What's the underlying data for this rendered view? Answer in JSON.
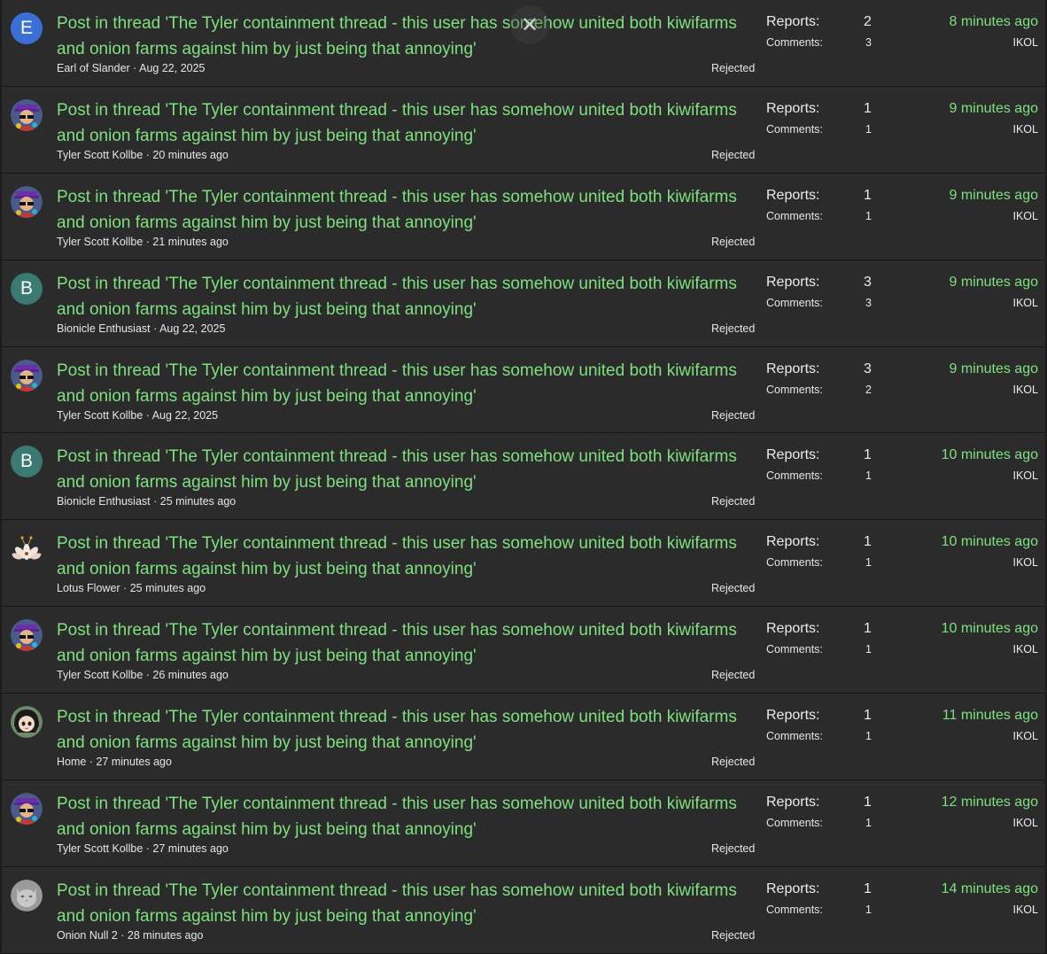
{
  "labels": {
    "reports": "Reports:",
    "comments": "Comments:"
  },
  "overlay": {
    "close_glyph": "✕"
  },
  "reports": [
    {
      "title": "Post in thread 'The Tyler containment thread - this user has somehow united both kiwifarms and onion farms against him by just being that annoying'",
      "author": "Earl of Slander",
      "date": "Aug 22, 2025",
      "status": "Rejected",
      "reports": "2",
      "comments": "3",
      "time": "8 minutes ago",
      "assignee": "IKOL",
      "avatar": {
        "type": "letter",
        "letter": "E",
        "color": "#3c6ed8",
        "icon": "letter-avatar"
      }
    },
    {
      "title": "Post in thread 'The Tyler containment thread - this user has somehow united both kiwifarms and onion farms against him by just being that annoying'",
      "author": "Tyler Scott Kollbe",
      "date": "20 minutes ago",
      "status": "Rejected",
      "reports": "1",
      "comments": "1",
      "time": "9 minutes ago",
      "assignee": "IKOL",
      "avatar": {
        "type": "tyler",
        "icon": "tyler-avatar"
      }
    },
    {
      "title": "Post in thread 'The Tyler containment thread - this user has somehow united both kiwifarms and onion farms against him by just being that annoying'",
      "author": "Tyler Scott Kollbe",
      "date": "21 minutes ago",
      "status": "Rejected",
      "reports": "1",
      "comments": "1",
      "time": "9 minutes ago",
      "assignee": "IKOL",
      "avatar": {
        "type": "tyler",
        "icon": "tyler-avatar"
      }
    },
    {
      "title": "Post in thread 'The Tyler containment thread - this user has somehow united both kiwifarms and onion farms against him by just being that annoying'",
      "author": "Bionicle Enthusiast",
      "date": "Aug 22, 2025",
      "status": "Rejected",
      "reports": "3",
      "comments": "3",
      "time": "9 minutes ago",
      "assignee": "IKOL",
      "avatar": {
        "type": "letter",
        "letter": "B",
        "color": "#3b7a73",
        "icon": "letter-avatar"
      }
    },
    {
      "title": "Post in thread 'The Tyler containment thread - this user has somehow united both kiwifarms and onion farms against him by just being that annoying'",
      "author": "Tyler Scott Kollbe",
      "date": "Aug 22, 2025",
      "status": "Rejected",
      "reports": "3",
      "comments": "2",
      "time": "9 minutes ago",
      "assignee": "IKOL",
      "avatar": {
        "type": "tyler",
        "icon": "tyler-avatar"
      }
    },
    {
      "title": "Post in thread 'The Tyler containment thread - this user has somehow united both kiwifarms and onion farms against him by just being that annoying'",
      "author": "Bionicle Enthusiast",
      "date": "25 minutes ago",
      "status": "Rejected",
      "reports": "1",
      "comments": "1",
      "time": "10 minutes ago",
      "assignee": "IKOL",
      "avatar": {
        "type": "letter",
        "letter": "B",
        "color": "#3b7a73",
        "icon": "letter-avatar"
      }
    },
    {
      "title": "Post in thread 'The Tyler containment thread - this user has somehow united both kiwifarms and onion farms against him by just being that annoying'",
      "author": "Lotus Flower",
      "date": "25 minutes ago",
      "status": "Rejected",
      "reports": "1",
      "comments": "1",
      "time": "10 minutes ago",
      "assignee": "IKOL",
      "avatar": {
        "type": "lotus",
        "icon": "lotus-flower-avatar"
      }
    },
    {
      "title": "Post in thread 'The Tyler containment thread - this user has somehow united both kiwifarms and onion farms against him by just being that annoying'",
      "author": "Tyler Scott Kollbe",
      "date": "26 minutes ago",
      "status": "Rejected",
      "reports": "1",
      "comments": "1",
      "time": "10 minutes ago",
      "assignee": "IKOL",
      "avatar": {
        "type": "tyler",
        "icon": "tyler-avatar"
      }
    },
    {
      "title": "Post in thread 'The Tyler containment thread - this user has somehow united both kiwifarms and onion farms against him by just being that annoying'",
      "author": "Home",
      "date": "27 minutes ago",
      "status": "Rejected",
      "reports": "1",
      "comments": "1",
      "time": "11 minutes ago",
      "assignee": "IKOL",
      "avatar": {
        "type": "home",
        "icon": "anime-girl-avatar"
      }
    },
    {
      "title": "Post in thread 'The Tyler containment thread - this user has somehow united both kiwifarms and onion farms against him by just being that annoying'",
      "author": "Tyler Scott Kollbe",
      "date": "27 minutes ago",
      "status": "Rejected",
      "reports": "1",
      "comments": "1",
      "time": "12 minutes ago",
      "assignee": "IKOL",
      "avatar": {
        "type": "tyler",
        "icon": "tyler-avatar"
      }
    },
    {
      "title": "Post in thread 'The Tyler containment thread - this user has somehow united both kiwifarms and onion farms against him by just being that annoying'",
      "author": "Onion Null 2",
      "date": "28 minutes ago",
      "status": "Rejected",
      "reports": "1",
      "comments": "1",
      "time": "14 minutes ago",
      "assignee": "IKOL",
      "avatar": {
        "type": "cat",
        "icon": "grey-cat-avatar"
      }
    }
  ]
}
